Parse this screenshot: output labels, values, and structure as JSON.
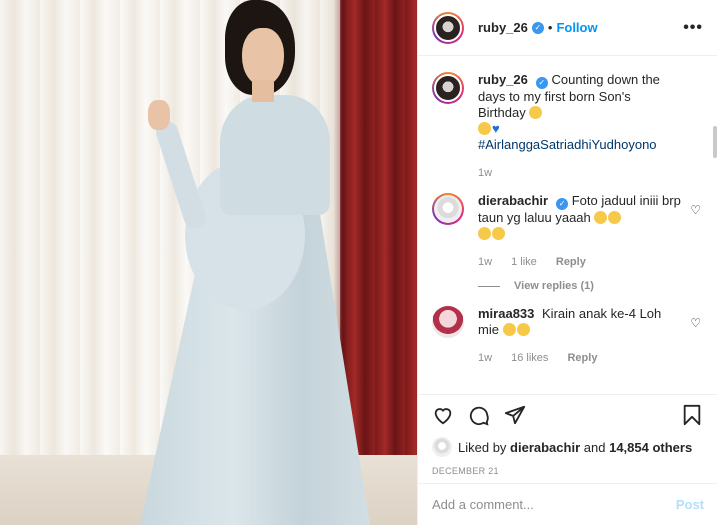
{
  "post": {
    "username": "ruby_26",
    "follow_label": "Follow",
    "separator": "•",
    "more_label": "•••",
    "photo_alt": "post photo"
  },
  "caption": {
    "username": "ruby_26",
    "text": "Counting down the days to my first born Son's Birthday",
    "hashtag": "#AirlanggaSatriadhiYudhoyono",
    "time": "1w"
  },
  "comments": [
    {
      "username": "dierabachir",
      "text": "Foto jaduul iniii brp taun yg laluu yaaah",
      "time": "1w",
      "likes": "1 like",
      "reply": "Reply",
      "view_replies": "View replies (1)"
    },
    {
      "username": "miraa833",
      "text": "Kirain anak ke-4 Loh mie",
      "time": "1w",
      "likes": "16 likes",
      "reply": "Reply"
    }
  ],
  "likes": {
    "prefix": "Liked by",
    "user": "dierabachir",
    "middle": "and",
    "count": "14,854 others"
  },
  "date": "DECEMBER 21",
  "add_comment": {
    "placeholder": "Add a comment...",
    "post_label": "Post"
  },
  "colors": {
    "accent": "#0095f6",
    "verified": "#3897f0",
    "muted": "#8e8e8e",
    "hashtag": "#00376b"
  },
  "icons": [
    "heart-icon",
    "comment-icon",
    "share-icon",
    "bookmark-icon",
    "verified-icon",
    "more-icon"
  ]
}
